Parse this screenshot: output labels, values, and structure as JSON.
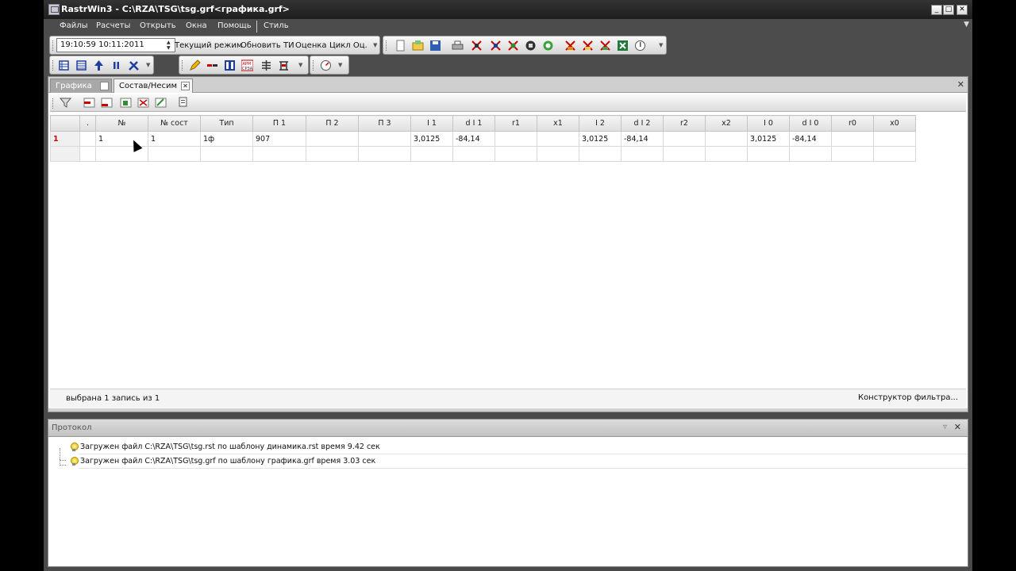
{
  "window": {
    "title": "RastrWin3 - C:\\RZA\\TSG\\tsg.grf<графика.grf>"
  },
  "menu": {
    "items": [
      "Файлы",
      "Расчеты",
      "Открыть",
      "Окна",
      "Помощь"
    ],
    "style": "Стиль"
  },
  "toolbar1": {
    "datetime": "19:10:59  10:11:2011",
    "mode": "Текущий режим",
    "update_ti": "Обновить ТИ",
    "estimate": "Оценка",
    "cycle": "Цикл Оц."
  },
  "tabs": [
    {
      "label": "Графика",
      "active": false
    },
    {
      "label": "Состав/Несим",
      "active": true
    }
  ],
  "table": {
    "columns": [
      ".",
      "№",
      "№ сост",
      "Тип",
      "П 1",
      "П 2",
      "П 3",
      "I 1",
      "d I 1",
      "r1",
      "x1",
      "I 2",
      "d I 2",
      "r2",
      "x2",
      "I 0",
      "d I 0",
      "r0",
      "x0"
    ],
    "rows": [
      {
        "num": "1",
        "cells": [
          "",
          "1",
          "1",
          "1ф",
          "907",
          "",
          "",
          "3,0125",
          "-84,14",
          "",
          "",
          "3,0125",
          "-84,14",
          "",
          "",
          "3,0125",
          "-84,14",
          "",
          ""
        ]
      }
    ]
  },
  "status": {
    "selection": "выбрана 1 запись из 1",
    "filter_builder": "Конструктор фильтра..."
  },
  "protocol": {
    "title": "Протокол",
    "lines": [
      "Загружен файл C:\\RZA\\TSG\\tsg.rst по шаблону динамика.rst время 9.42 сек",
      "Загружен файл C:\\RZA\\TSG\\tsg.grf по шаблону графика.grf время 3.03 сек"
    ]
  },
  "colors": {
    "accent_red": "#cc0000",
    "chrome_dark": "#4a4a4a"
  }
}
